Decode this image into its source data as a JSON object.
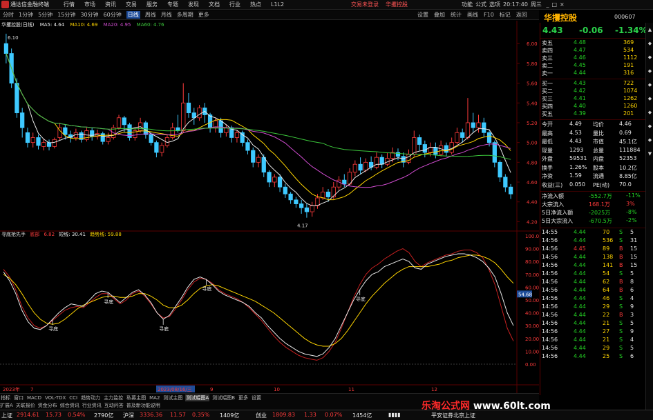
{
  "titlebar": {
    "app_name": "通达信金融终端",
    "menu": [
      "行情",
      "市场",
      "资讯",
      "交易",
      "服务",
      "专题",
      "发现",
      "文档",
      "行业",
      "热点",
      "L1L2"
    ],
    "notices": [
      "交易未登录",
      "华攫控股"
    ],
    "right": [
      "功能",
      "公式",
      "选项",
      "20:17:40",
      "周三"
    ]
  },
  "toolbar": {
    "periods": [
      "分时",
      "1分钟",
      "5分钟",
      "15分钟",
      "30分钟",
      "60分钟",
      "日线",
      "周线",
      "月线",
      "多周期",
      "更多"
    ],
    "active_period": "日线",
    "tools": [
      "设置",
      "叠加",
      "统计",
      "画线",
      "F10",
      "标记",
      "返回"
    ]
  },
  "stock": {
    "name": "华攫控股",
    "code": "000607",
    "chart_title": "华攫控股(日线)"
  },
  "ma_legend": [
    {
      "label": "MA5: 4.64",
      "color": "#e8e8e8"
    },
    {
      "label": "MA10: 4.69",
      "color": "#ffd500"
    },
    {
      "label": "MA20: 4.95",
      "color": "#d04cd0"
    },
    {
      "label": "MA60: 4.76",
      "color": "#3cc83c"
    }
  ],
  "price_axis": [
    "6.00",
    "5.80",
    "5.60",
    "5.40",
    "5.20",
    "5.00",
    "4.80",
    "4.60",
    "4.40",
    "4.20"
  ],
  "price_annotations": {
    "high": "6.10",
    "low": "4.17"
  },
  "oscillator": {
    "name": "寻底抢先手",
    "legend": [
      {
        "label": "底部",
        "color": "#ff3b3b"
      },
      {
        "label": "6.82",
        "color": "#ff3b3b"
      },
      {
        "label": "短线: 30.41",
        "color": "#e8e8e8"
      },
      {
        "label": "趋势线: 59.88",
        "color": "#ffd500"
      }
    ],
    "axis": [
      "100.00",
      "90.00",
      "80.00",
      "70.00",
      "60.00",
      "50.00",
      "40.00",
      "30.00",
      "20.00",
      "10.00",
      "0.00"
    ],
    "current_value": "54.68",
    "bottom_label": "寻底",
    "jump_label": "寻底"
  },
  "date_axis": [
    "2023年",
    "7",
    "2023/08/16/三",
    "9",
    "10",
    "11",
    "12"
  ],
  "quote": {
    "price": "4.43",
    "change": "-0.06",
    "change_pct": "-1.34%",
    "asks": [
      {
        "label": "卖五",
        "price": "4.48",
        "vol": "369"
      },
      {
        "label": "卖四",
        "price": "4.47",
        "vol": "534"
      },
      {
        "label": "卖三",
        "price": "4.46",
        "vol": "1112"
      },
      {
        "label": "卖二",
        "price": "4.45",
        "vol": "191"
      },
      {
        "label": "卖一",
        "price": "4.44",
        "vol": "316"
      }
    ],
    "bids": [
      {
        "label": "买一",
        "price": "4.43",
        "vol": "722"
      },
      {
        "label": "买二",
        "price": "4.42",
        "vol": "1074"
      },
      {
        "label": "买三",
        "price": "4.41",
        "vol": "1262"
      },
      {
        "label": "买四",
        "price": "4.40",
        "vol": "1260"
      },
      {
        "label": "买五",
        "price": "4.39",
        "vol": "201"
      }
    ],
    "stats": [
      {
        "l1": "今开",
        "v1": "4.49",
        "l2": "均价",
        "v2": "4.46"
      },
      {
        "l1": "最高",
        "v1": "4.53",
        "l2": "量比",
        "v2": "0.69"
      },
      {
        "l1": "最低",
        "v1": "4.43",
        "l2": "市值",
        "v2": "45.1亿"
      },
      {
        "l1": "现量",
        "v1": "1293",
        "l2": "总量",
        "v2": "111884"
      },
      {
        "l1": "外盘",
        "v1": "59531",
        "l2": "内盘",
        "v2": "52353"
      },
      {
        "l1": "换手",
        "v1": "1.26%",
        "l2": "股本",
        "v2": "10.2亿"
      },
      {
        "l1": "净资",
        "v1": "1.59",
        "l2": "流通",
        "v2": "8.85亿"
      },
      {
        "l1": "收益(三)",
        "v1": "0.050",
        "l2": "PE(动)",
        "v2": "70.0"
      }
    ],
    "flows": [
      {
        "label": "净流入额",
        "value": "-552.7万",
        "pct": "-11%"
      },
      {
        "label": "大宗流入",
        "value": "168.1万",
        "pct": "3%"
      },
      {
        "label": "5日净流入额",
        "value": "-2025万",
        "pct": "-8%"
      },
      {
        "label": "5日大宗流入",
        "value": "-670.5万",
        "pct": "-2%"
      }
    ],
    "ticks": [
      {
        "time": "14:55",
        "price": "4.44",
        "vol": "70",
        "side": "S",
        "n": "5"
      },
      {
        "time": "14:56",
        "price": "4.44",
        "vol": "536",
        "side": "S",
        "n": "31"
      },
      {
        "time": "14:56",
        "price": "4.45",
        "vol": "89",
        "side": "B",
        "n": "15"
      },
      {
        "time": "14:56",
        "price": "4.44",
        "vol": "138",
        "side": "B",
        "n": "15"
      },
      {
        "time": "14:56",
        "price": "4.44",
        "vol": "141",
        "side": "B",
        "n": "15"
      },
      {
        "time": "14:56",
        "price": "4.44",
        "vol": "54",
        "side": "S",
        "n": "5"
      },
      {
        "time": "14:56",
        "price": "4.44",
        "vol": "62",
        "side": "B",
        "n": "8"
      },
      {
        "time": "14:56",
        "price": "4.44",
        "vol": "64",
        "side": "B",
        "n": "6"
      },
      {
        "time": "14:56",
        "price": "4.44",
        "vol": "46",
        "side": "S",
        "n": "4"
      },
      {
        "time": "14:56",
        "price": "4.44",
        "vol": "29",
        "side": "S",
        "n": "9"
      },
      {
        "time": "14:56",
        "price": "4.44",
        "vol": "22",
        "side": "B",
        "n": "3"
      },
      {
        "time": "14:56",
        "price": "4.44",
        "vol": "21",
        "side": "S",
        "n": "5"
      },
      {
        "time": "14:56",
        "price": "4.44",
        "vol": "27",
        "side": "S",
        "n": "9"
      },
      {
        "time": "14:56",
        "price": "4.44",
        "vol": "21",
        "side": "S",
        "n": "4"
      },
      {
        "time": "14:56",
        "price": "4.44",
        "vol": "29",
        "side": "S",
        "n": "5"
      },
      {
        "time": "14:56",
        "price": "4.44",
        "vol": "25",
        "side": "S",
        "n": "6"
      }
    ]
  },
  "bottom_tabs": [
    "指标",
    "窗口",
    "MACD",
    "VOL-TDX",
    "CCI",
    "趋势动力",
    "主力监控",
    "私募主图",
    "MA2",
    "测试主图",
    "测试幅图A",
    "测试幅图B",
    "更多",
    "设置"
  ],
  "bottom_tabs2": [
    "扩展A",
    "关联报价",
    "资金分布",
    "综合资讯",
    "行业资讯",
    "互动问答",
    "普及新功能说明"
  ],
  "index_bar": [
    {
      "name": "上证",
      "value": "2914.61",
      "chg": "15.73",
      "pct": "0.54%",
      "amt": "2790亿"
    },
    {
      "name": "沪深",
      "value": "3336.36",
      "chg": "11.57",
      "pct": "0.35%",
      "amt": "1409亿"
    },
    {
      "name": "创业",
      "value": "1809.83",
      "chg": "1.33",
      "pct": "0.07%",
      "amt": "1454亿"
    }
  ],
  "broker": "平安证券北京上证",
  "watermark": {
    "brand": "乐淘公式网",
    "url": "www.60lt.com"
  },
  "chart_data": {
    "type": "candlestick",
    "title": "华攫控股(日线)",
    "ylim": [
      4.17,
      6.1
    ],
    "candles": [
      [
        6.0,
        5.9,
        6.1,
        5.8
      ],
      [
        5.9,
        5.6,
        5.95,
        5.55
      ],
      [
        5.6,
        5.3,
        5.65,
        5.25
      ],
      [
        5.3,
        5.15,
        5.35,
        5.05
      ],
      [
        5.1,
        5.0,
        5.15,
        4.95
      ],
      [
        5.0,
        5.05,
        5.1,
        4.95
      ],
      [
        5.05,
        4.97,
        5.08,
        4.93
      ],
      [
        4.96,
        5.0,
        5.04,
        4.92
      ],
      [
        5.0,
        4.96,
        5.03,
        4.92
      ],
      [
        4.96,
        5.03,
        5.05,
        4.94
      ],
      [
        5.05,
        5.15,
        5.2,
        5.02
      ],
      [
        5.15,
        5.08,
        5.18,
        5.03
      ],
      [
        5.08,
        5.05,
        5.12,
        5.0
      ],
      [
        5.05,
        5.1,
        5.14,
        5.02
      ],
      [
        5.1,
        5.03,
        5.12,
        5.0
      ],
      [
        5.03,
        5.12,
        5.15,
        5.01
      ],
      [
        5.12,
        5.06,
        5.15,
        5.02
      ],
      [
        5.06,
        5.09,
        5.13,
        5.03
      ],
      [
        5.09,
        5.01,
        5.11,
        4.98
      ],
      [
        5.01,
        5.05,
        5.1,
        4.98
      ],
      [
        5.05,
        5.15,
        5.18,
        5.03
      ],
      [
        5.15,
        5.25,
        5.28,
        5.13
      ],
      [
        5.25,
        5.18,
        5.27,
        5.1
      ],
      [
        5.18,
        5.05,
        5.2,
        5.02
      ],
      [
        5.05,
        5.12,
        5.15,
        5.02
      ],
      [
        5.12,
        5.2,
        5.25,
        5.1
      ],
      [
        5.2,
        5.08,
        5.22,
        5.04
      ],
      [
        5.08,
        5.0,
        5.1,
        4.97
      ],
      [
        5.0,
        4.9,
        5.02,
        4.85
      ],
      [
        4.9,
        4.97,
        5.0,
        4.86
      ],
      [
        4.97,
        5.05,
        5.08,
        4.95
      ],
      [
        5.05,
        5.15,
        5.2,
        5.03
      ],
      [
        5.15,
        5.12,
        5.28,
        5.1
      ],
      [
        5.12,
        5.4,
        5.6,
        5.1
      ],
      [
        5.4,
        5.3,
        5.5,
        5.25
      ],
      [
        5.3,
        5.25,
        5.35,
        5.18
      ],
      [
        5.25,
        5.35,
        5.38,
        5.22
      ],
      [
        5.35,
        5.28,
        5.4,
        5.2
      ],
      [
        5.28,
        5.15,
        5.3,
        5.1
      ],
      [
        5.15,
        5.22,
        5.25,
        5.1
      ],
      [
        5.22,
        5.1,
        5.25,
        5.05
      ],
      [
        5.1,
        5.15,
        5.18,
        5.06
      ],
      [
        5.15,
        5.05,
        5.17,
        5.0
      ],
      [
        5.05,
        5.1,
        5.12,
        5.0
      ],
      [
        5.1,
        5.0,
        5.12,
        4.96
      ],
      [
        5.0,
        4.92,
        5.03,
        4.88
      ],
      [
        4.92,
        4.8,
        4.95,
        4.75
      ],
      [
        4.8,
        4.85,
        4.88,
        4.75
      ],
      [
        4.85,
        4.7,
        4.88,
        4.65
      ],
      [
        4.7,
        4.6,
        4.72,
        4.55
      ],
      [
        4.6,
        4.65,
        4.68,
        4.55
      ],
      [
        4.65,
        4.55,
        4.68,
        4.5
      ],
      [
        4.55,
        4.48,
        4.58,
        4.44
      ],
      [
        4.48,
        4.42,
        4.5,
        4.38
      ],
      [
        4.42,
        4.38,
        4.45,
        4.34
      ],
      [
        4.38,
        4.34,
        4.42,
        4.28
      ],
      [
        4.34,
        4.3,
        4.38,
        4.24
      ],
      [
        4.3,
        4.36,
        4.4,
        4.25
      ],
      [
        4.36,
        4.44,
        4.48,
        4.33
      ],
      [
        4.44,
        4.5,
        4.55,
        4.42
      ],
      [
        4.5,
        4.45,
        4.53,
        4.4
      ],
      [
        4.45,
        4.55,
        4.6,
        4.43
      ],
      [
        4.55,
        4.62,
        4.66,
        4.52
      ],
      [
        4.62,
        4.58,
        4.68,
        4.55
      ],
      [
        4.58,
        4.7,
        4.74,
        4.56
      ],
      [
        4.7,
        4.78,
        4.82,
        4.66
      ],
      [
        4.78,
        4.72,
        4.85,
        4.68
      ],
      [
        4.72,
        4.8,
        4.84,
        4.7
      ],
      [
        4.8,
        4.75,
        4.86,
        4.72
      ],
      [
        4.75,
        4.85,
        4.9,
        4.73
      ],
      [
        4.85,
        4.78,
        4.88,
        4.74
      ],
      [
        4.78,
        4.84,
        4.9,
        4.76
      ],
      [
        4.84,
        4.9,
        4.95,
        4.8
      ],
      [
        4.9,
        4.86,
        4.94,
        4.82
      ],
      [
        4.86,
        4.8,
        4.9,
        4.75
      ],
      [
        4.8,
        4.88,
        4.93,
        4.78
      ],
      [
        4.88,
        5.05,
        5.12,
        4.86
      ],
      [
        5.05,
        4.98,
        5.08,
        4.92
      ],
      [
        4.98,
        4.9,
        5.02,
        4.85
      ],
      [
        4.9,
        4.95,
        5.0,
        4.86
      ],
      [
        4.95,
        4.88,
        5.0,
        4.84
      ],
      [
        4.88,
        4.97,
        5.02,
        4.86
      ],
      [
        4.97,
        4.9,
        5.0,
        4.86
      ],
      [
        4.9,
        5.0,
        5.05,
        4.88
      ],
      [
        5.0,
        5.1,
        5.15,
        4.98
      ],
      [
        5.1,
        5.05,
        5.14,
        5.0
      ],
      [
        5.05,
        5.2,
        5.45,
        5.03
      ],
      [
        5.2,
        5.15,
        5.3,
        5.1
      ],
      [
        5.15,
        5.2,
        5.28,
        5.1
      ],
      [
        5.2,
        5.1,
        5.25,
        5.05
      ],
      [
        5.1,
        5.0,
        5.12,
        4.96
      ],
      [
        5.0,
        4.8,
        5.02,
        4.75
      ],
      [
        4.8,
        4.65,
        4.82,
        4.6
      ],
      [
        4.65,
        4.55,
        4.68,
        4.5
      ],
      [
        4.55,
        4.48,
        4.58,
        4.43
      ]
    ],
    "oscillator": {
      "short": [
        72,
        65,
        55,
        42,
        33,
        28,
        27,
        30,
        35,
        40,
        44,
        47,
        46,
        45,
        50,
        55,
        57,
        56,
        52,
        48,
        52,
        56,
        58,
        54,
        48,
        40,
        35,
        38,
        45,
        52,
        60,
        66,
        68,
        66,
        62,
        57,
        54,
        52,
        50,
        48,
        45,
        40,
        36,
        30,
        25,
        20,
        16,
        13,
        10,
        8,
        7,
        6,
        8,
        13,
        20,
        30,
        40,
        50,
        58,
        65,
        70,
        72,
        76,
        78,
        80,
        82,
        80,
        75,
        74,
        78,
        80,
        82,
        84,
        85,
        86,
        86,
        85,
        83,
        80,
        75,
        68,
        55,
        40,
        30
      ],
      "long": [
        70,
        67,
        62,
        55,
        47,
        40,
        35,
        32,
        31,
        32,
        35,
        39,
        43,
        46,
        48,
        50,
        52,
        53,
        53,
        52,
        52,
        53,
        55,
        55,
        53,
        50,
        46,
        44,
        44,
        46,
        50,
        55,
        59,
        61,
        62,
        61,
        59,
        57,
        55,
        53,
        51,
        49,
        46,
        43,
        40,
        36,
        32,
        28,
        24,
        20,
        17,
        15,
        14,
        14,
        16,
        20,
        26,
        33,
        40,
        47,
        53,
        58,
        63,
        67,
        71,
        74,
        76,
        76,
        76,
        76,
        77,
        78,
        80,
        81,
        83,
        84,
        85,
        85,
        84,
        82,
        79,
        74,
        68,
        63
      ],
      "bottom_line": [
        74,
        68,
        58,
        45,
        36,
        30,
        28,
        30,
        34,
        38,
        42,
        44,
        45,
        44,
        48,
        52,
        55,
        55,
        51,
        47,
        50,
        55,
        57,
        53,
        47,
        40,
        36,
        37,
        43,
        50,
        58,
        64,
        67,
        66,
        63,
        58,
        55,
        53,
        51,
        48,
        44,
        39,
        34,
        28,
        22,
        17,
        13,
        10,
        7,
        5,
        4,
        3,
        5,
        10,
        17,
        28,
        40,
        52,
        62,
        70,
        75,
        78,
        82,
        85,
        88,
        90,
        87,
        80,
        76,
        79,
        81,
        83,
        85,
        86,
        88,
        89,
        89,
        87,
        83,
        74,
        62,
        45,
        28,
        18
      ],
      "signals": [
        {
          "index": 8,
          "label": "寻底"
        },
        {
          "index": 17,
          "label": "寻底"
        },
        {
          "index": 26,
          "label": "寻底"
        },
        {
          "index": 33,
          "label": "寻底"
        },
        {
          "index": 58,
          "label": "寻底"
        }
      ]
    }
  }
}
